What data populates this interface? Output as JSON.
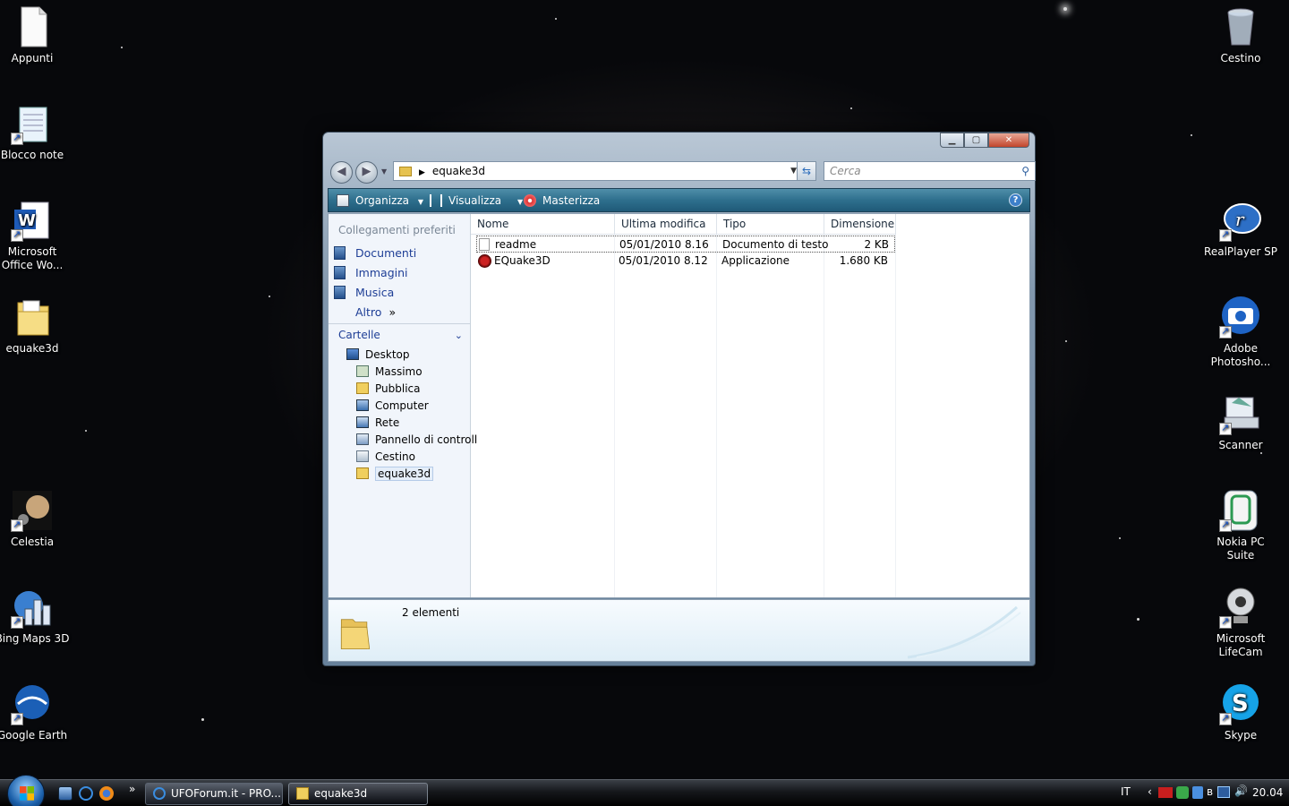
{
  "desktop": {
    "left_icons": [
      {
        "label": "Appunti",
        "icon": "text-document-icon"
      },
      {
        "label": "Blocco note",
        "icon": "notepad-icon"
      },
      {
        "label": "Microsoft Office Wo...",
        "icon": "word-icon"
      },
      {
        "label": "equake3d",
        "icon": "folder-icon"
      },
      {
        "label": "Celestia",
        "icon": "celestia-icon"
      },
      {
        "label": "Bing Maps 3D",
        "icon": "bing-maps-icon"
      },
      {
        "label": "Google Earth",
        "icon": "google-earth-icon"
      }
    ],
    "right_icons": [
      {
        "label": "Cestino",
        "icon": "recycle-bin-icon"
      },
      {
        "label": "RealPlayer SP",
        "icon": "realplayer-icon"
      },
      {
        "label": "Adobe Photosho...",
        "icon": "camera-icon"
      },
      {
        "label": "Scanner",
        "icon": "scanner-icon"
      },
      {
        "label": "Nokia PC Suite",
        "icon": "nokia-pc-suite-icon"
      },
      {
        "label": "Microsoft LifeCam",
        "icon": "webcam-icon"
      },
      {
        "label": "Skype",
        "icon": "skype-icon"
      }
    ]
  },
  "window": {
    "address": "equake3d",
    "search_placeholder": "Cerca",
    "toolbar": {
      "organize": "Organizza",
      "view": "Visualizza",
      "burn": "Masterizza"
    },
    "nav": {
      "favorites_header": "Collegamenti preferiti",
      "favorites": [
        "Documenti",
        "Immagini",
        "Musica"
      ],
      "more": "Altro",
      "more_chevron": "»",
      "folders_header": "Cartelle",
      "tree": [
        {
          "label": "Desktop",
          "icon": "desktop-icon"
        },
        {
          "label": "Massimo",
          "icon": "user-folder-icon"
        },
        {
          "label": "Pubblica",
          "icon": "folder-icon"
        },
        {
          "label": "Computer",
          "icon": "computer-icon"
        },
        {
          "label": "Rete",
          "icon": "network-icon"
        },
        {
          "label": "Pannello di controll",
          "icon": "control-panel-icon"
        },
        {
          "label": "Cestino",
          "icon": "recycle-bin-icon"
        },
        {
          "label": "equake3d",
          "icon": "folder-icon"
        }
      ]
    },
    "columns": [
      "Nome",
      "Ultima modifica",
      "Tipo",
      "Dimensione"
    ],
    "files": [
      {
        "name": "readme",
        "modified": "05/01/2010 8.16",
        "type": "Documento di testo",
        "size": "2 KB",
        "icon": "text-file-icon"
      },
      {
        "name": "EQuake3D",
        "modified": "05/01/2010 8.12",
        "type": "Applicazione",
        "size": "1.680 KB",
        "icon": "application-icon"
      }
    ],
    "details": {
      "count": "2 elementi"
    }
  },
  "taskbar": {
    "buttons": [
      {
        "label": "UFOForum.it - PRO...",
        "icon": "internet-explorer-icon"
      },
      {
        "label": "equake3d",
        "icon": "folder-icon"
      }
    ],
    "overflow": "»",
    "language": "IT",
    "clock": "20.04"
  }
}
